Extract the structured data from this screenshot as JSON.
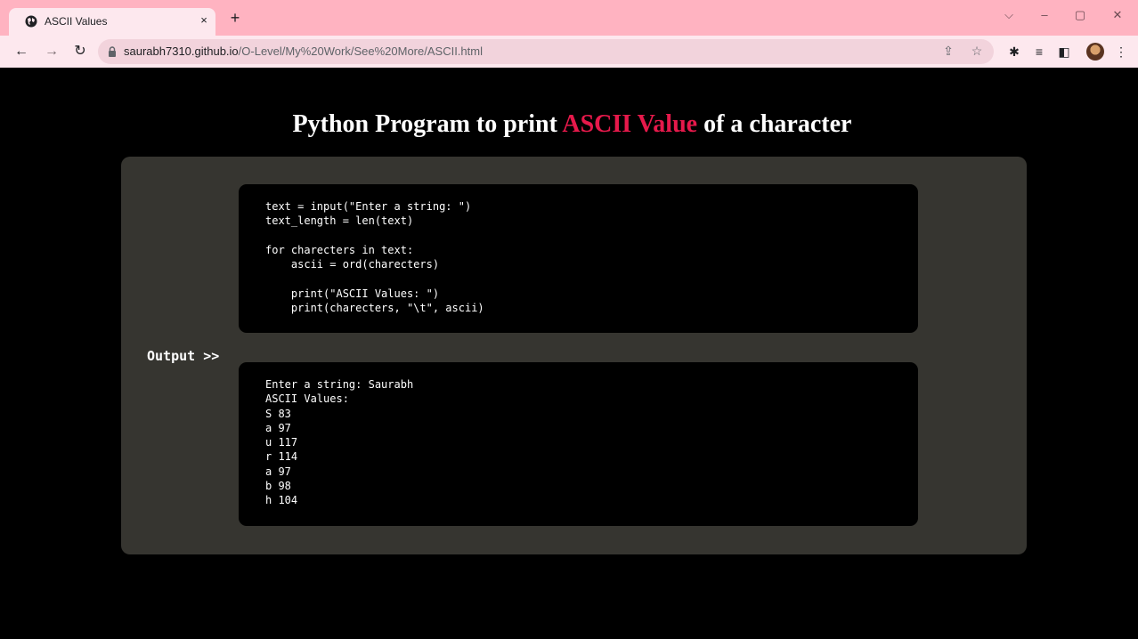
{
  "browser": {
    "tab_title": "ASCII Values",
    "tab_close": "×",
    "new_tab": "+",
    "url_domain": "saurabh7310.github.io",
    "url_path": "/O-Level/My%20Work/See%20More/ASCII.html",
    "window_controls": {
      "dropdown": "⌵",
      "minimize": "–",
      "restore": "▢",
      "close": "✕"
    },
    "nav": {
      "back": "←",
      "forward": "→",
      "reload": "↻"
    }
  },
  "page": {
    "title_before": "Python Program to print ",
    "title_highlight": "ASCII Value",
    "title_after": " of a character",
    "code": "text = input(\"Enter a string: \")\ntext_length = len(text)\n\nfor charecters in text:\n    ascii = ord(charecters)\n\n    print(\"ASCII Values: \")\n    print(charecters, \"\\t\", ascii)",
    "output_label": "Output >>",
    "output": "Enter a string: Saurabh\nASCII Values:\nS 83\na 97\nu 117\nr 114\na 97\nb 98\nh 104"
  },
  "colors": {
    "tabbar": "#ffb3c1",
    "toolbar": "#fde8ee",
    "card": "#363530",
    "highlight": "#e6194b"
  }
}
